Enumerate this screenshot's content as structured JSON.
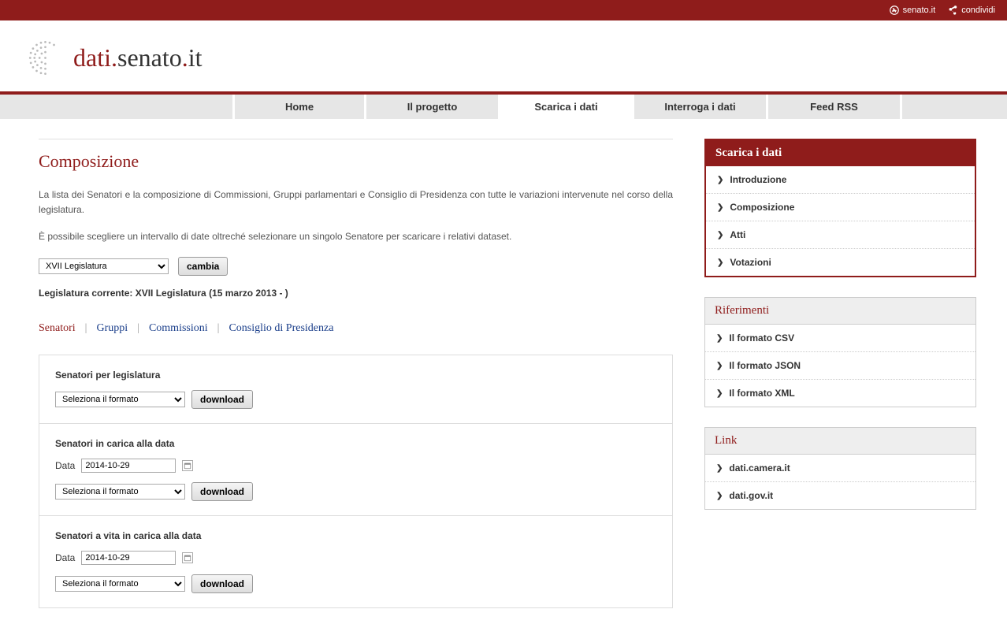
{
  "topbar": {
    "senato_link": "senato.it",
    "share_link": "condividi"
  },
  "logo": {
    "prefix": "dati",
    "suffix": "senato",
    "tld": "it"
  },
  "nav": {
    "items": [
      "Home",
      "Il progetto",
      "Scarica i dati",
      "Interroga i dati",
      "Feed RSS"
    ],
    "active_index": 2
  },
  "page": {
    "title": "Composizione",
    "intro1": "La lista dei Senatori e la composizione di Commissioni, Gruppi parlamentari e Consiglio di Presidenza con tutte le variazioni intervenute nel corso della legislatura.",
    "intro2": "È possibile scegliere un intervallo di date oltreché selezionare un singolo Senatore per scaricare i relativi dataset."
  },
  "legislature": {
    "select_value": "XVII Legislatura",
    "change_button": "cambia",
    "current_label": "Legislatura corrente: XVII Legislatura (15 marzo 2013 - )"
  },
  "tabs": {
    "items": [
      "Senatori",
      "Gruppi",
      "Commissioni",
      "Consiglio di Presidenza"
    ],
    "active_index": 0
  },
  "sections": [
    {
      "title": "Senatori per legislatura",
      "has_date": false,
      "format_placeholder": "Seleziona il formato",
      "download_label": "download"
    },
    {
      "title": "Senatori in carica alla data",
      "has_date": true,
      "date_label": "Data",
      "date_value": "2014-10-29",
      "format_placeholder": "Seleziona il formato",
      "download_label": "download"
    },
    {
      "title": "Senatori a vita in carica alla data",
      "has_date": true,
      "date_label": "Data",
      "date_value": "2014-10-29",
      "format_placeholder": "Seleziona il formato",
      "download_label": "download"
    }
  ],
  "sidebar": {
    "box1": {
      "title": "Scarica i dati",
      "items": [
        "Introduzione",
        "Composizione",
        "Atti",
        "Votazioni"
      ]
    },
    "box2": {
      "title": "Riferimenti",
      "items": [
        "Il formato CSV",
        "Il formato JSON",
        "Il formato XML"
      ]
    },
    "box3": {
      "title": "Link",
      "items": [
        "dati.camera.it",
        "dati.gov.it"
      ]
    }
  }
}
